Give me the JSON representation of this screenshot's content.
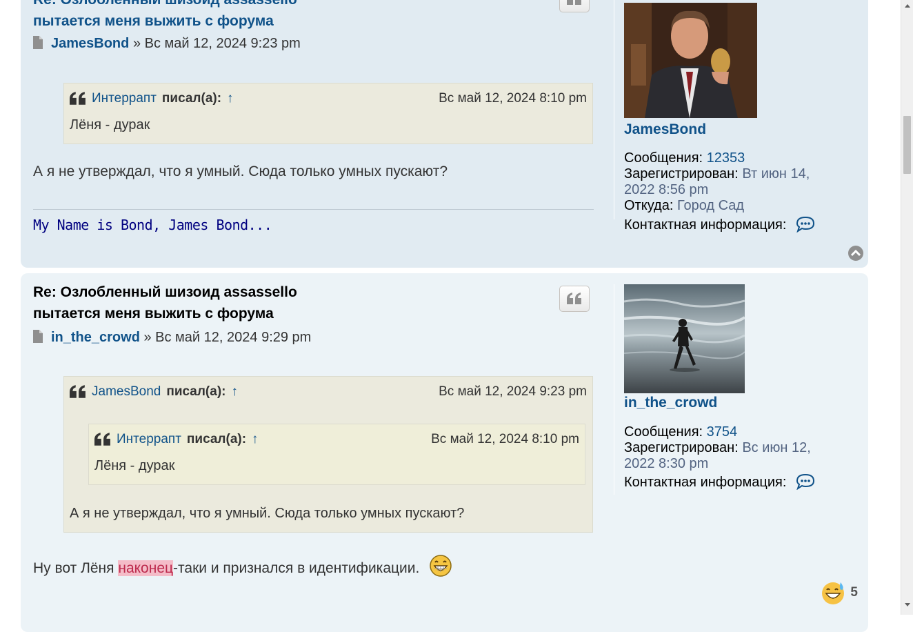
{
  "posts": [
    {
      "title_line1": "Re: Озлобленный шизоид assassello",
      "title_line2": "пытается меня выжить с форума",
      "author": "JamesBond",
      "date": "» Вс май 12, 2024 9:23 pm",
      "quote": {
        "who": "Интеррапт",
        "wrote": "писал(а):",
        "up": "↑",
        "date": "Вс май 12, 2024 8:10 pm",
        "text": "Лёня - дурак"
      },
      "text": "А я не утверждал, что я умный. Сюда только умных пускают?",
      "signature": "My Name is Bond, James Bond...",
      "profile": {
        "username": "JamesBond",
        "posts_label": "Сообщения:",
        "posts_value": "12353",
        "registered_label": "Зарегистрирован:",
        "registered_value_1": "Вт июн 14,",
        "registered_value_2": "2022 8:56 pm",
        "from_label": "Откуда:",
        "from_value": "Город Сад",
        "contact_label": "Контактная информация:"
      }
    },
    {
      "title_line1": "Re: Озлобленный шизоид assassello",
      "title_line2": "пытается меня выжить с форума",
      "author": "in_the_crowd",
      "date": "» Вс май 12, 2024 9:29 pm",
      "quote": {
        "who": "JamesBond",
        "wrote": "писал(а):",
        "up": "↑",
        "date": "Вс май 12, 2024 9:23 pm",
        "inner": {
          "who": "Интеррапт",
          "wrote": "писал(а):",
          "up": "↑",
          "date": "Вс май 12, 2024 8:10 pm",
          "text": "Лёня - дурак"
        },
        "text": "А я не утверждал, что я умный. Сюда только умных пускают?"
      },
      "text_before": "Ну вот Лёня ",
      "text_highlight": "наконец",
      "text_after": "-таки и признался в идентификации.",
      "reaction_count": "5",
      "profile": {
        "username": "in_the_crowd",
        "posts_label": "Сообщения:",
        "posts_value": "3754",
        "registered_label": "Зарегистрирован:",
        "registered_value_1": "Вс июн 12,",
        "registered_value_2": "2022 8:30 pm",
        "contact_label": "Контактная информация:"
      }
    }
  ],
  "icons": {
    "document": "document-icon",
    "quote": "quote-icon",
    "contact": "chat-bubble-icon",
    "top": "chevron-up-circle-icon",
    "grin": "grin-emoji-icon",
    "sweat": "sweat-smile-emoji-icon"
  },
  "colors": {
    "link": "#105289",
    "post_bg_1": "#e1ebf2",
    "post_bg_2": "#ecf3f7",
    "quote_bg": "#ebeadd",
    "highlight_bg": "#f4bcc8",
    "signature": "#000080"
  }
}
